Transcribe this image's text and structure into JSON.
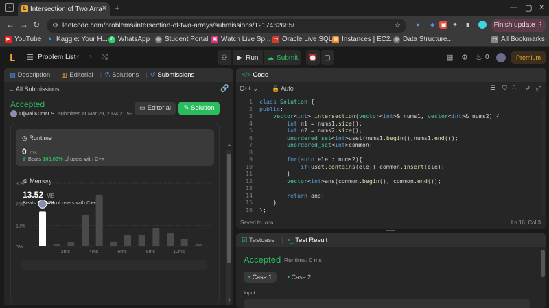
{
  "browser": {
    "tab_title": "Intersection of Two Arra",
    "url": "leetcode.com/problems/intersection-of-two-arrays/submissions/1217462685/",
    "finish_update": "Finish update",
    "bookmarks": [
      "YouTube",
      "Kaggle: Your H...",
      "WhatsApp",
      "Student Portal",
      "Watch Live Sp...",
      "Oracle Live SQL",
      "Instances | EC2...",
      "Data Structure..."
    ],
    "all_bookmarks": "All Bookmarks"
  },
  "nav": {
    "problem_list": "Problem List",
    "run": "Run",
    "submit": "Submit",
    "streak": "0",
    "premium": "Premium"
  },
  "left": {
    "tabs": [
      "Description",
      "Editorial",
      "Solutions",
      "Submissions"
    ],
    "all_submissions": "All Submissions",
    "status": "Accepted",
    "user": "Ujjwal Kumar S...",
    "submitted": "submitted at Mar 29, 2024 21:59",
    "editorial_btn": "Editorial",
    "solution_btn": "Solution",
    "runtime_label": "Runtime",
    "runtime_value": "0",
    "runtime_unit": "ms",
    "runtime_beats_pre": "Beats",
    "runtime_beats_pct": "100.00%",
    "runtime_beats_post": "of users with C++",
    "memory_label": "Memory",
    "memory_value": "13.52",
    "memory_unit": "MB",
    "memory_beats_pre": "Beats",
    "memory_beats_pct": "23.54%",
    "memory_beats_post": "of users with C++"
  },
  "chart_data": {
    "type": "bar",
    "y_ticks": [
      "30%",
      "20%",
      "10%",
      "0%"
    ],
    "x_ticks": [
      "2ms",
      "4ms",
      "6ms",
      "8ms",
      "10ms"
    ],
    "ylim": [
      0,
      30
    ],
    "values": [
      16.5,
      1,
      2,
      15,
      24.5,
      2,
      5.5,
      5.5,
      8.5,
      6.3,
      3.5,
      1
    ],
    "highlight_index": 0
  },
  "code": {
    "title": "Code",
    "language": "C++",
    "mode": "Auto",
    "lines": [
      "class Solution {",
      "public:",
      "    vector<int> intersection(vector<int>& nums1, vector<int>& nums2) {",
      "        int n1 = nums1.size();",
      "        int n2 = nums2.size();",
      "        unordered_set<int>uset(nums1.begin(),nums1.end());",
      "        unordered_set<int>common;",
      "",
      "        for(auto ele : nums2){",
      "            if(uset.contains(ele)) common.insert(ele);",
      "        }",
      "        vector<int>ans(common.begin(), common.end());",
      "",
      "        return ans;",
      "    }",
      "};"
    ],
    "saved": "Saved to local",
    "position": "Ln 16, Col 3"
  },
  "test": {
    "tab_testcase": "Testcase",
    "tab_result": "Test Result",
    "status": "Accepted",
    "runtime": "Runtime: 0 ms",
    "case1": "Case 1",
    "case2": "Case 2",
    "input_label": "Input"
  }
}
